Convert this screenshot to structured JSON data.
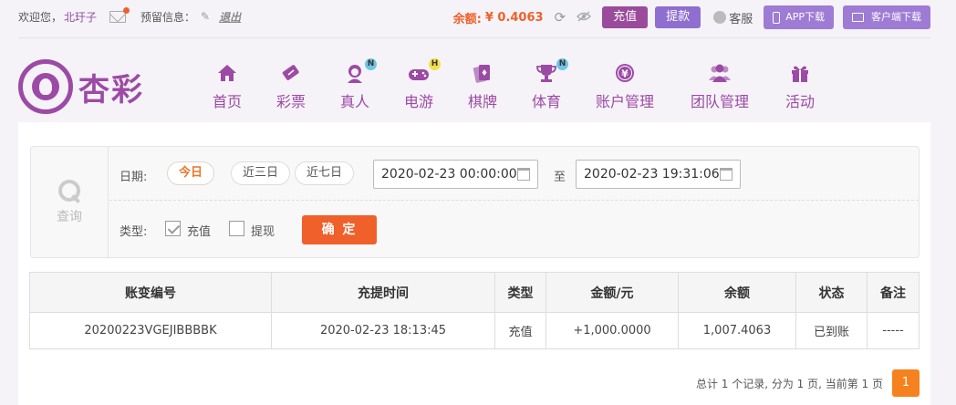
{
  "topbar": {
    "welcome": "欢迎您，",
    "username": "北玗子",
    "reserve_label": "预留信息：",
    "logout": "退出",
    "balance_label": "余额:",
    "balance_value": "¥ 0.4063",
    "deposit": "充值",
    "withdraw": "提款",
    "service": "客服",
    "app_download": "APP下载",
    "client_download": "客户端下载"
  },
  "logo": {
    "text": "杏彩"
  },
  "nav": [
    {
      "label": "首页",
      "icon": "home-icon",
      "badge": ""
    },
    {
      "label": "彩票",
      "icon": "ticket-icon",
      "badge": ""
    },
    {
      "label": "真人",
      "icon": "dealer-icon",
      "badge": "N"
    },
    {
      "label": "电游",
      "icon": "gamepad-icon",
      "badge": "H"
    },
    {
      "label": "棋牌",
      "icon": "cards-icon",
      "badge": ""
    },
    {
      "label": "体育",
      "icon": "trophy-icon",
      "badge": "N"
    },
    {
      "label": "账户管理",
      "icon": "yen-coin-icon",
      "badge": ""
    },
    {
      "label": "团队管理",
      "icon": "team-icon",
      "badge": ""
    },
    {
      "label": "活动",
      "icon": "gift-icon",
      "badge": ""
    }
  ],
  "query": {
    "side_label": "查询",
    "date_label": "日期:",
    "quick": [
      "今日",
      "近三日",
      "近七日"
    ],
    "start": "2020-02-23 00:00:00",
    "to": "至",
    "end": "2020-02-23 19:31:06",
    "type_label": "类型:",
    "types": [
      {
        "label": "充值",
        "checked": true
      },
      {
        "label": "提现",
        "checked": false
      }
    ],
    "confirm": "确 定"
  },
  "table": {
    "headers": [
      "账变编号",
      "充提时间",
      "类型",
      "金额/元",
      "余额",
      "状态",
      "备注"
    ],
    "rows": [
      [
        "20200223VGEJIBBBBK",
        "2020-02-23 18:13:45",
        "充值",
        "+1,000.0000",
        "1,007.4063",
        "已到账",
        "-----"
      ]
    ]
  },
  "pager": {
    "summary": "总计 1 个记录, 分为 1 页, 当前第 1 页",
    "current": "1"
  }
}
